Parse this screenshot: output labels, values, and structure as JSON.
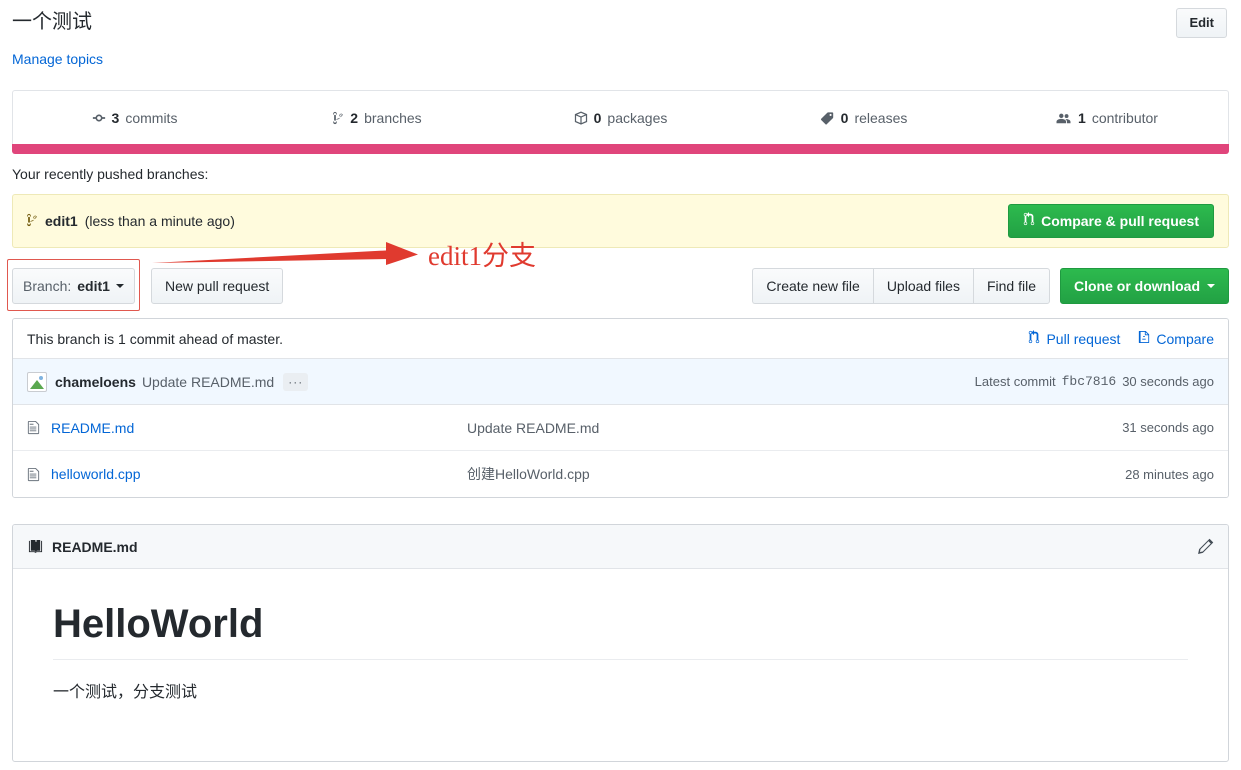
{
  "header": {
    "repo_title": "一个测试",
    "manage_topics": "Manage topics",
    "edit_label": "Edit"
  },
  "summary": {
    "items": [
      {
        "icon": "commit-icon",
        "count": "3",
        "label": "commits"
      },
      {
        "icon": "branch-icon",
        "count": "2",
        "label": "branches"
      },
      {
        "icon": "package-icon",
        "count": "0",
        "label": "packages"
      },
      {
        "icon": "tag-icon",
        "count": "0",
        "label": "releases"
      },
      {
        "icon": "people-icon",
        "count": "1",
        "label": "contributor"
      }
    ],
    "language_bar_color": "#e0457b"
  },
  "recently_pushed": {
    "label": "Your recently pushed branches:",
    "branch": "edit1",
    "time": "(less than a minute ago)",
    "compare_pr_label": "Compare & pull request"
  },
  "toolbar": {
    "branch_prefix": "Branch:",
    "branch_value": "edit1",
    "new_pull_request": "New pull request",
    "create_new_file": "Create new file",
    "upload_files": "Upload files",
    "find_file": "Find file",
    "clone_or_download": "Clone or download"
  },
  "annotation": {
    "text": "edit1分支",
    "color": "#e03a2f"
  },
  "branch_status": {
    "text": "This branch is 1 commit ahead of master.",
    "pull_request": "Pull request",
    "compare": "Compare"
  },
  "latest_commit": {
    "author": "chameloens",
    "message": "Update README.md",
    "expand": "···",
    "prefix": "Latest commit",
    "sha": "fbc7816",
    "time": "30 seconds ago"
  },
  "files": [
    {
      "name": "README.md",
      "message": "Update README.md",
      "time": "31 seconds ago"
    },
    {
      "name": "helloworld.cpp",
      "message": "创建HelloWorld.cpp",
      "time": "28 minutes ago"
    }
  ],
  "readme": {
    "title": "README.md",
    "heading": "HelloWorld",
    "paragraph": "一个测试，分支测试"
  }
}
